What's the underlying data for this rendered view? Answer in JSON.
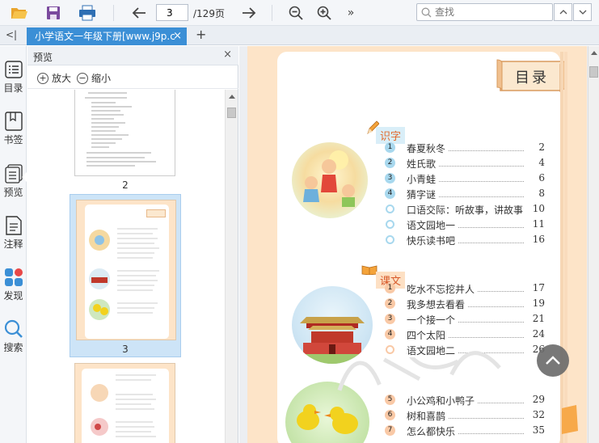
{
  "toolbar": {
    "page_current": "3",
    "page_total": "/129页",
    "search_placeholder": "查找"
  },
  "tab": {
    "title": "小学语文一年级下册[www.j9p.c",
    "close": "×",
    "add": "+"
  },
  "sidebar": {
    "collapse": "<|",
    "items": [
      {
        "label": "目录"
      },
      {
        "label": "书签"
      },
      {
        "label": "预览"
      },
      {
        "label": "注释"
      },
      {
        "label": "发现"
      },
      {
        "label": "搜索"
      }
    ]
  },
  "panel": {
    "title": "预览",
    "close": "×",
    "zoom_in": "放大",
    "zoom_out": "缩小",
    "thumbs": [
      {
        "num": "2"
      },
      {
        "num": "3"
      }
    ]
  },
  "page": {
    "toc_title": "目录",
    "sections": [
      {
        "label": "识字",
        "items": [
          {
            "n": "1",
            "title": "春夏秋冬",
            "page": "2"
          },
          {
            "n": "2",
            "title": "姓氏歌",
            "page": "4"
          },
          {
            "n": "3",
            "title": "小青蛙",
            "page": "6"
          },
          {
            "n": "4",
            "title": "猜字谜",
            "page": "8"
          },
          {
            "n": "",
            "title": "口语交际：听故事，讲故事",
            "page": "10"
          },
          {
            "n": "",
            "title": "语文园地一",
            "page": "11"
          },
          {
            "n": "",
            "title": "快乐读书吧",
            "page": "16"
          }
        ]
      },
      {
        "label": "课文",
        "items": [
          {
            "n": "1",
            "title": "吃水不忘挖井人",
            "page": "17"
          },
          {
            "n": "2",
            "title": "我多想去看看",
            "page": "19"
          },
          {
            "n": "3",
            "title": "一个接一个",
            "page": "21"
          },
          {
            "n": "4",
            "title": "四个太阳",
            "page": "24"
          },
          {
            "n": "",
            "title": "语文园地二",
            "page": "26"
          },
          {
            "n": "5",
            "title": "小公鸡和小鸭子",
            "page": "29"
          },
          {
            "n": "6",
            "title": "树和喜鹊",
            "page": "32"
          },
          {
            "n": "7",
            "title": "怎么都快乐",
            "page": "35"
          }
        ]
      }
    ]
  },
  "colors": {
    "accent": "#3b8fd6",
    "page_bg": "#fde4c8",
    "section1_num": "#a8d8ee",
    "section2_num": "#f9c9a6"
  }
}
